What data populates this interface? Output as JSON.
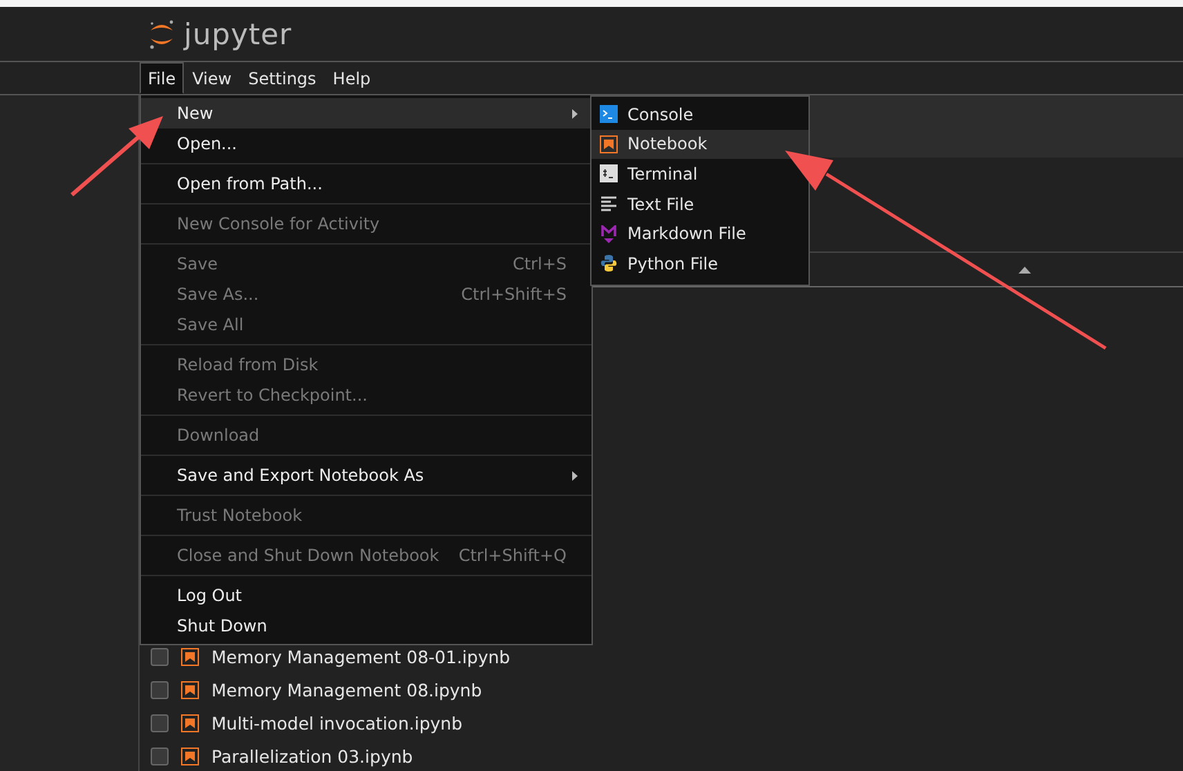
{
  "header": {
    "logo_text": "jupyter"
  },
  "menubar": [
    {
      "label": "File",
      "selected": true
    },
    {
      "label": "View",
      "selected": false
    },
    {
      "label": "Settings",
      "selected": false
    },
    {
      "label": "Help",
      "selected": false
    }
  ],
  "file_menu": {
    "sections": [
      [
        {
          "label": "New",
          "disabled": false,
          "selected": true,
          "submenu": true
        },
        {
          "label": "Open...",
          "disabled": false,
          "selected": false,
          "submenu": false
        }
      ],
      [
        {
          "label": "Open from Path...",
          "disabled": false,
          "selected": false,
          "submenu": false
        }
      ],
      [
        {
          "label": "New Console for Activity",
          "disabled": true,
          "selected": false,
          "submenu": false
        }
      ],
      [
        {
          "label": "Save",
          "shortcut": "Ctrl+S",
          "disabled": true,
          "selected": false,
          "submenu": false
        },
        {
          "label": "Save As...",
          "shortcut": "Ctrl+Shift+S",
          "disabled": true,
          "selected": false,
          "submenu": false
        },
        {
          "label": "Save All",
          "disabled": true,
          "selected": false,
          "submenu": false
        }
      ],
      [
        {
          "label": "Reload from Disk",
          "disabled": true,
          "selected": false,
          "submenu": false
        },
        {
          "label": "Revert to Checkpoint...",
          "disabled": true,
          "selected": false,
          "submenu": false
        }
      ],
      [
        {
          "label": "Download",
          "disabled": true,
          "selected": false,
          "submenu": false
        }
      ],
      [
        {
          "label": "Save and Export Notebook As",
          "disabled": false,
          "selected": false,
          "submenu": true
        }
      ],
      [
        {
          "label": "Trust Notebook",
          "disabled": true,
          "selected": false,
          "submenu": false
        }
      ],
      [
        {
          "label": "Close and Shut Down Notebook",
          "shortcut": "Ctrl+Shift+Q",
          "disabled": true,
          "selected": false,
          "submenu": false
        }
      ],
      [
        {
          "label": "Log Out",
          "disabled": false,
          "selected": false,
          "submenu": false
        },
        {
          "label": "Shut Down",
          "disabled": false,
          "selected": false,
          "submenu": false
        }
      ]
    ]
  },
  "new_submenu": [
    {
      "label": "Console",
      "kind": "console",
      "selected": false
    },
    {
      "label": "Notebook",
      "kind": "notebook",
      "selected": true
    },
    {
      "label": "Terminal",
      "kind": "terminal",
      "selected": false
    },
    {
      "label": "Text File",
      "kind": "text",
      "selected": false
    },
    {
      "label": "Markdown File",
      "kind": "markdown",
      "selected": false
    },
    {
      "label": "Python File",
      "kind": "python",
      "selected": false
    }
  ],
  "files": [
    {
      "name": "Memory Management 08-01.ipynb",
      "checked": false
    },
    {
      "name": "Memory Management 08.ipynb",
      "checked": false
    },
    {
      "name": "Multi-model invocation.ipynb",
      "checked": false
    },
    {
      "name": "Parallelization 03.ipynb",
      "checked": false
    }
  ]
}
